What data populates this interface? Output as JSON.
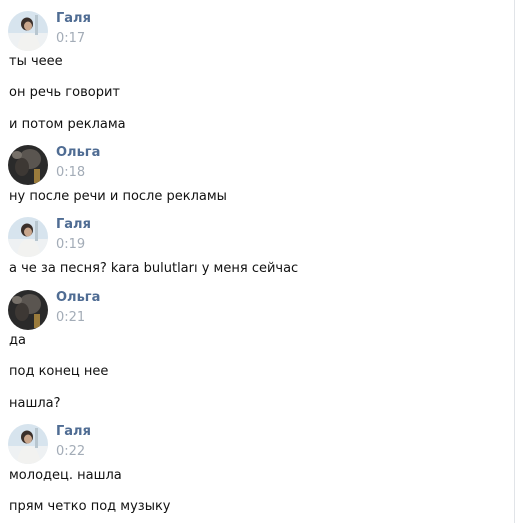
{
  "conversation": {
    "groups": [
      {
        "author": "Галя",
        "avatar_icon": "avatar-galya",
        "time": "0:17",
        "messages": [
          "ты чеее",
          "он речь говорит",
          "и потом реклама"
        ]
      },
      {
        "author": "Ольга",
        "avatar_icon": "avatar-olga",
        "time": "0:18",
        "messages": [
          "ну после речи и после рекламы"
        ]
      },
      {
        "author": "Галя",
        "avatar_icon": "avatar-galya",
        "time": "0:19",
        "messages": [
          "а че за песня? kara bulutları у меня сейчас"
        ]
      },
      {
        "author": "Ольга",
        "avatar_icon": "avatar-olga",
        "time": "0:21",
        "messages": [
          "да",
          "под конец нее",
          "нашла?"
        ]
      },
      {
        "author": "Галя",
        "avatar_icon": "avatar-galya",
        "time": "0:22",
        "messages": [
          "молодец. нашла",
          "прям четко под музыку"
        ]
      }
    ]
  },
  "colors": {
    "author_name": "#4f6c93",
    "timestamp": "#a3acb7",
    "message_text": "#111111",
    "background": "#ffffff"
  }
}
